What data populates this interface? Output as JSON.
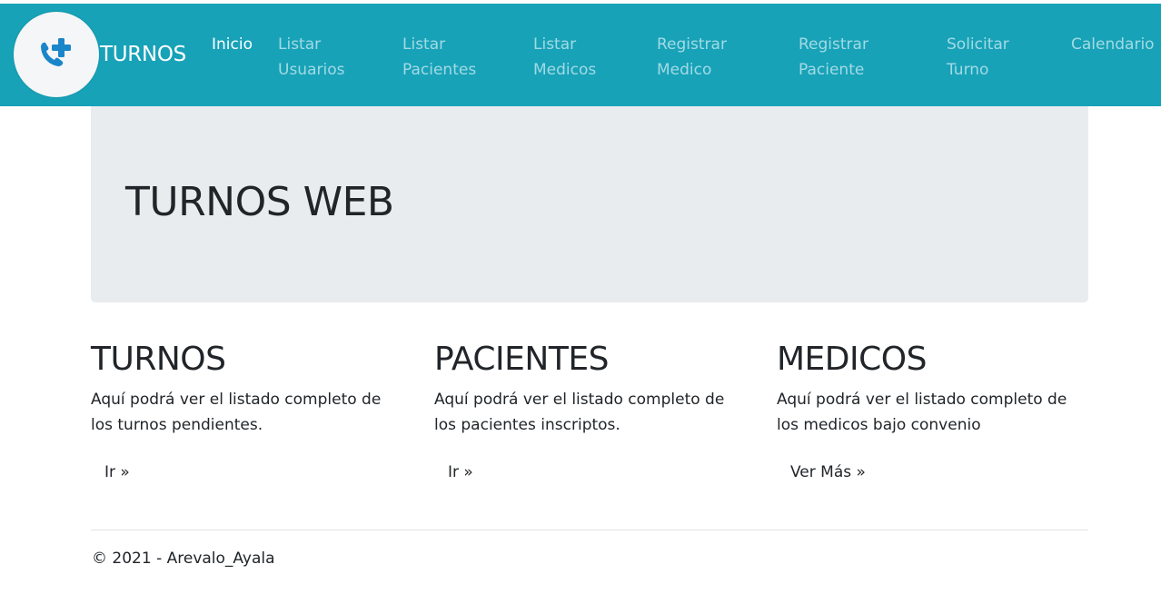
{
  "colors": {
    "navbar": "#17a2b8",
    "jumbotron": "#e9ecef",
    "logo_icon": "#1a86c9"
  },
  "brand": {
    "logo_icon": "phone-plus-icon",
    "name": "TURNOS"
  },
  "nav": [
    {
      "line1": "Inicio",
      "line2": ""
    },
    {
      "line1": "Listar",
      "line2": "Usuarios"
    },
    {
      "line1": "Listar",
      "line2": "Pacientes"
    },
    {
      "line1": "Listar",
      "line2": "Medicos"
    },
    {
      "line1": "Registrar",
      "line2": "Medico"
    },
    {
      "line1": "Registrar",
      "line2": "Paciente"
    },
    {
      "line1": "Solicitar",
      "line2": "Turno"
    },
    {
      "line1": "Calendario",
      "line2": ""
    }
  ],
  "jumbotron": {
    "title": "TURNOS WEB"
  },
  "sections": [
    {
      "title": "TURNOS",
      "text": "Aquí podrá ver el listado completo de los turnos pendientes.",
      "button": "Ir »"
    },
    {
      "title": "PACIENTES",
      "text": "Aquí podrá ver el listado completo de los pacientes inscriptos.",
      "button": "Ir »"
    },
    {
      "title": "MEDICOS",
      "text": "Aquí podrá ver el listado completo de los medicos bajo convenio",
      "button": "Ver Más »"
    }
  ],
  "footer": {
    "text": "© 2021 - Arevalo_Ayala"
  }
}
